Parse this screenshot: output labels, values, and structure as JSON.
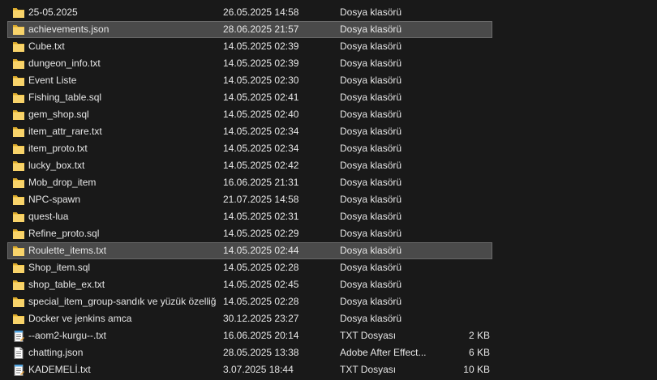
{
  "colors": {
    "background": "#191919",
    "text": "#e6e6e6",
    "selection": "#4a4a4a",
    "folder": "#f4c542"
  },
  "files": [
    {
      "name": "25-05.2025",
      "date": "26.05.2025 14:58",
      "type": "Dosya klasörü",
      "size": "",
      "icon": "folder-icon",
      "selected": false
    },
    {
      "name": "achievements.json",
      "date": "28.06.2025 21:57",
      "type": "Dosya klasörü",
      "size": "",
      "icon": "folder-icon",
      "selected": true
    },
    {
      "name": "Cube.txt",
      "date": "14.05.2025 02:39",
      "type": "Dosya klasörü",
      "size": "",
      "icon": "folder-icon",
      "selected": false
    },
    {
      "name": "dungeon_info.txt",
      "date": "14.05.2025 02:39",
      "type": "Dosya klasörü",
      "size": "",
      "icon": "folder-icon",
      "selected": false
    },
    {
      "name": "Event Liste",
      "date": "14.05.2025 02:30",
      "type": "Dosya klasörü",
      "size": "",
      "icon": "folder-icon",
      "selected": false
    },
    {
      "name": "Fishing_table.sql",
      "date": "14.05.2025 02:41",
      "type": "Dosya klasörü",
      "size": "",
      "icon": "folder-icon",
      "selected": false
    },
    {
      "name": "gem_shop.sql",
      "date": "14.05.2025 02:40",
      "type": "Dosya klasörü",
      "size": "",
      "icon": "folder-icon",
      "selected": false
    },
    {
      "name": "item_attr_rare.txt",
      "date": "14.05.2025 02:34",
      "type": "Dosya klasörü",
      "size": "",
      "icon": "folder-icon",
      "selected": false
    },
    {
      "name": "item_proto.txt",
      "date": "14.05.2025 02:34",
      "type": "Dosya klasörü",
      "size": "",
      "icon": "folder-icon",
      "selected": false
    },
    {
      "name": "lucky_box.txt",
      "date": "14.05.2025 02:42",
      "type": "Dosya klasörü",
      "size": "",
      "icon": "folder-icon",
      "selected": false
    },
    {
      "name": "Mob_drop_item",
      "date": "16.06.2025 21:31",
      "type": "Dosya klasörü",
      "size": "",
      "icon": "folder-icon",
      "selected": false
    },
    {
      "name": "NPC-spawn",
      "date": "21.07.2025 14:58",
      "type": "Dosya klasörü",
      "size": "",
      "icon": "folder-icon",
      "selected": false
    },
    {
      "name": "quest-lua",
      "date": "14.05.2025 02:31",
      "type": "Dosya klasörü",
      "size": "",
      "icon": "folder-icon",
      "selected": false
    },
    {
      "name": "Refine_proto.sql",
      "date": "14.05.2025 02:29",
      "type": "Dosya klasörü",
      "size": "",
      "icon": "folder-icon",
      "selected": false
    },
    {
      "name": "Roulette_items.txt",
      "date": "14.05.2025 02:44",
      "type": "Dosya klasörü",
      "size": "",
      "icon": "folder-icon",
      "selected": true
    },
    {
      "name": "Shop_item.sql",
      "date": "14.05.2025 02:28",
      "type": "Dosya klasörü",
      "size": "",
      "icon": "folder-icon",
      "selected": false
    },
    {
      "name": "shop_table_ex.txt",
      "date": "14.05.2025 02:45",
      "type": "Dosya klasörü",
      "size": "",
      "icon": "folder-icon",
      "selected": false
    },
    {
      "name": "special_item_group-sandık ve yüzük özelliği",
      "date": "14.05.2025 02:28",
      "type": "Dosya klasörü",
      "size": "",
      "icon": "folder-icon",
      "selected": false
    },
    {
      "name": "Docker ve jenkins amca",
      "date": "30.12.2025 23:27",
      "type": "Dosya klasörü",
      "size": "",
      "icon": "folder-icon",
      "selected": false
    },
    {
      "name": "--aom2-kurgu--.txt",
      "date": "16.06.2025 20:14",
      "type": "TXT Dosyası",
      "size": "2 KB",
      "icon": "notepad-icon",
      "selected": false
    },
    {
      "name": "chatting.json",
      "date": "28.05.2025 13:38",
      "type": "Adobe After Effect...",
      "size": "6 KB",
      "icon": "document-icon",
      "selected": false
    },
    {
      "name": "KADEMELİ.txt",
      "date": "3.07.2025 18:44",
      "type": "TXT Dosyası",
      "size": "10 KB",
      "icon": "notepad-icon",
      "selected": false
    }
  ]
}
